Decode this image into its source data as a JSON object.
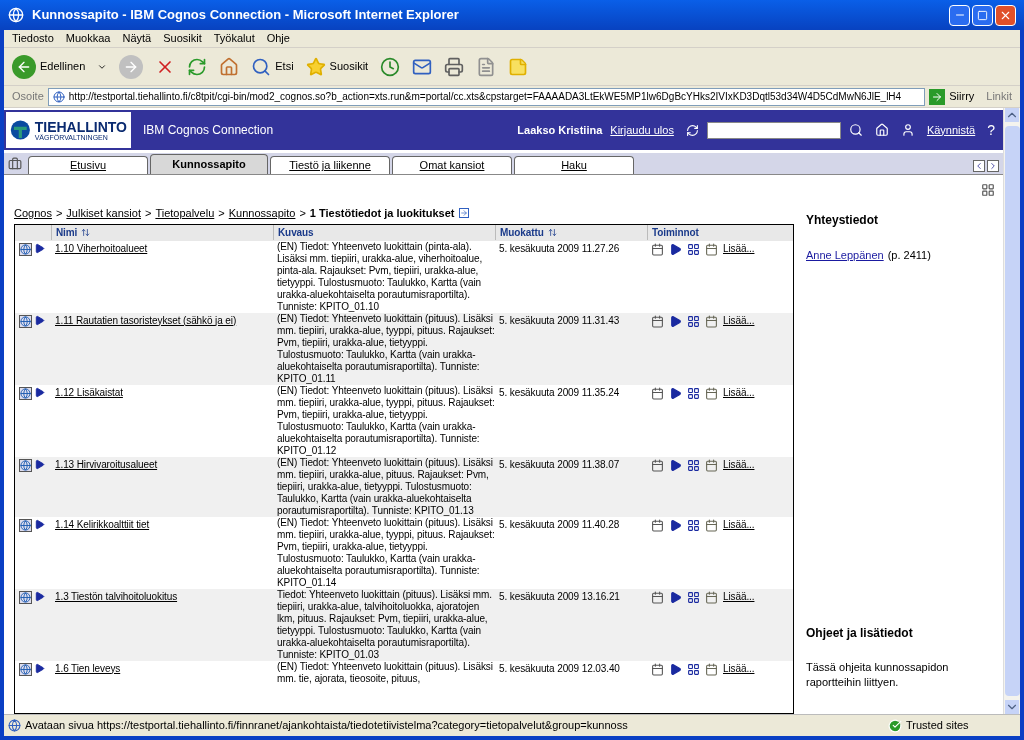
{
  "window": {
    "title": "Kunnossapito - IBM Cognos Connection - Microsoft Internet Explorer"
  },
  "menu": [
    "Tiedosto",
    "Muokkaa",
    "Näytä",
    "Suosikit",
    "Työkalut",
    "Ohje"
  ],
  "toolbar": {
    "back": "Edellinen",
    "search": "Etsi",
    "favorites": "Suosikit"
  },
  "address": {
    "label": "Osoite",
    "url": "http://testportal.tiehallinto.fi/c8tpit/cgi-bin/mod2_cognos.so?b_action=xts.run&m=portal/cc.xts&cpstarget=FAAAADA3LtEkWE5MP1lw6DgBcYHks2IVIxKD3Dqtl53d34W4D5CdMwN6JlE_lH4",
    "go": "Siirry",
    "links": "Linkit"
  },
  "portal": {
    "logo_main": "TIEHALLINTO",
    "logo_sub": "VÄGFÖRVALTNINGEN",
    "app": "IBM Cognos Connection",
    "user": "Laakso Kristiina",
    "logout": "Kirjaudu ulos",
    "launch": "Käynnistä",
    "help": "?"
  },
  "tabs": [
    {
      "label": "Etusivu",
      "selected": false
    },
    {
      "label": "Kunnossapito",
      "selected": true
    },
    {
      "label": "Tiestö ja liikenne",
      "selected": false
    },
    {
      "label": "Omat kansiot",
      "selected": false
    },
    {
      "label": "Haku",
      "selected": false
    }
  ],
  "breadcrumb": [
    {
      "label": "Cognos",
      "current": false
    },
    {
      "label": "Julkiset kansiot",
      "current": false
    },
    {
      "label": "Tietopalvelu",
      "current": false
    },
    {
      "label": "Kunnossapito",
      "current": false
    },
    {
      "label": "1 Tiestötiedot ja luokitukset",
      "current": true
    }
  ],
  "breadcrumb_separator": ">",
  "table": {
    "columns": [
      {
        "label": "Nimi",
        "sortable": true
      },
      {
        "label": "Kuvaus",
        "sortable": false
      },
      {
        "label": "Muokattu",
        "sortable": true
      },
      {
        "label": "Toiminnot",
        "sortable": false
      }
    ],
    "rows": [
      {
        "name": "1.10 Viherhoitoalueet",
        "description": "(EN) Tiedot: Yhteenveto luokittain (pinta-ala). Lisäksi mm. tiepiiri, urakka-alue, viherhoitoalue, pinta-ala. Rajaukset: Pvm, tiepiiri, urakka-alue, tietyyppi. Tulostusmuoto: Taulukko, Kartta (vain urakka-aluekohtaiselta porautumisraportilta). Tunniste: KPITO_01.10",
        "modified": "5. kesäkuuta 2009 11.27.26",
        "more": "Lisää..."
      },
      {
        "name": "1.11 Rautatien tasoristeykset (sähkö ja ei)",
        "description": "(EN) Tiedot: Yhteenveto luokittain (pituus). Lisäksi mm. tiepiiri, urakka-alue, tyyppi, pituus. Rajaukset: Pvm, tiepiiri, urakka-alue, tietyyppi. Tulostusmuoto: Taulukko, Kartta (vain urakka-aluekohtaiselta porautumisraportilta). Tunniste: KPITO_01.11",
        "modified": "5. kesäkuuta 2009 11.31.43",
        "more": "Lisää..."
      },
      {
        "name": "1.12 Lisäkaistat",
        "description": "(EN) Tiedot: Yhteenveto luokittain (pituus). Lisäksi mm. tiepiiri, urakka-alue, tyyppi, pituus. Rajaukset: Pvm, tiepiiri, urakka-alue, tietyyppi. Tulostusmuoto: Taulukko, Kartta (vain urakka-aluekohtaiselta porautumisraportilta). Tunniste: KPITO_01.12",
        "modified": "5. kesäkuuta 2009 11.35.24",
        "more": "Lisää..."
      },
      {
        "name": "1.13 Hirvivaroitusalueet",
        "description": "(EN) Tiedot: Yhteenveto luokittain (pituus). Lisäksi mm. tiepiiri, urakka-alue, pituus. Rajaukset: Pvm, tiepiiri, urakka-alue, tietyyppi. Tulostusmuoto: Taulukko, Kartta (vain urakka-aluekohtaiselta porautumisraportilta). Tunniste: KPITO_01.13",
        "modified": "5. kesäkuuta 2009 11.38.07",
        "more": "Lisää..."
      },
      {
        "name": "1.14 Kelirikkoalttiit tiet",
        "description": "(EN) Tiedot: Yhteenveto luokittain (pituus). Lisäksi mm. tiepiiri, urakka-alue, tyyppi, pituus. Rajaukset: Pvm, tiepiiri, urakka-alue, tietyyppi. Tulostusmuoto: Taulukko, Kartta (vain urakka-aluekohtaiselta porautumisraportilta). Tunniste: KPITO_01.14",
        "modified": "5. kesäkuuta 2009 11.40.28",
        "more": "Lisää..."
      },
      {
        "name": "1.3 Tiestön talvihoitoluokitus",
        "description": "Tiedot: Yhteenveto luokittain (pituus). Lisäksi mm. tiepiiri, urakka-alue, talvihoitoluokka, ajoratojen lkm, pituus. Rajaukset: Pvm, tiepiiri, urakka-alue, tietyyppi. Tulostusmuoto: Taulukko, Kartta (vain urakka-aluekohtaiselta porautumisraportilta). Tunniste: KPITO_01.03",
        "modified": "5. kesäkuuta 2009 13.16.21",
        "more": "Lisää..."
      },
      {
        "name": "1.6 Tien leveys",
        "description": "(EN) Tiedot: Yhteenveto luokittain (pituus). Lisäksi mm. tie, ajorata, tieosoite, pituus,",
        "modified": "5. kesäkuuta 2009 12.03.40",
        "more": "Lisää..."
      }
    ]
  },
  "sidebar": [
    {
      "title": "Yhteystiedot",
      "link": "Anne Leppänen",
      "text": "(p. 2411)"
    },
    {
      "title": "Ohjeet ja lisätiedot",
      "text": "Tässä ohjeita kunnossapidon raportteihin liittyen."
    }
  ],
  "status": {
    "text": "Avataan sivua https://testportal.tiehallinto.fi/finnranet/ajankohtaista/tiedotetiivistelma?category=tietopalvelut&group=kunnoss",
    "zone": "Trusted sites"
  }
}
